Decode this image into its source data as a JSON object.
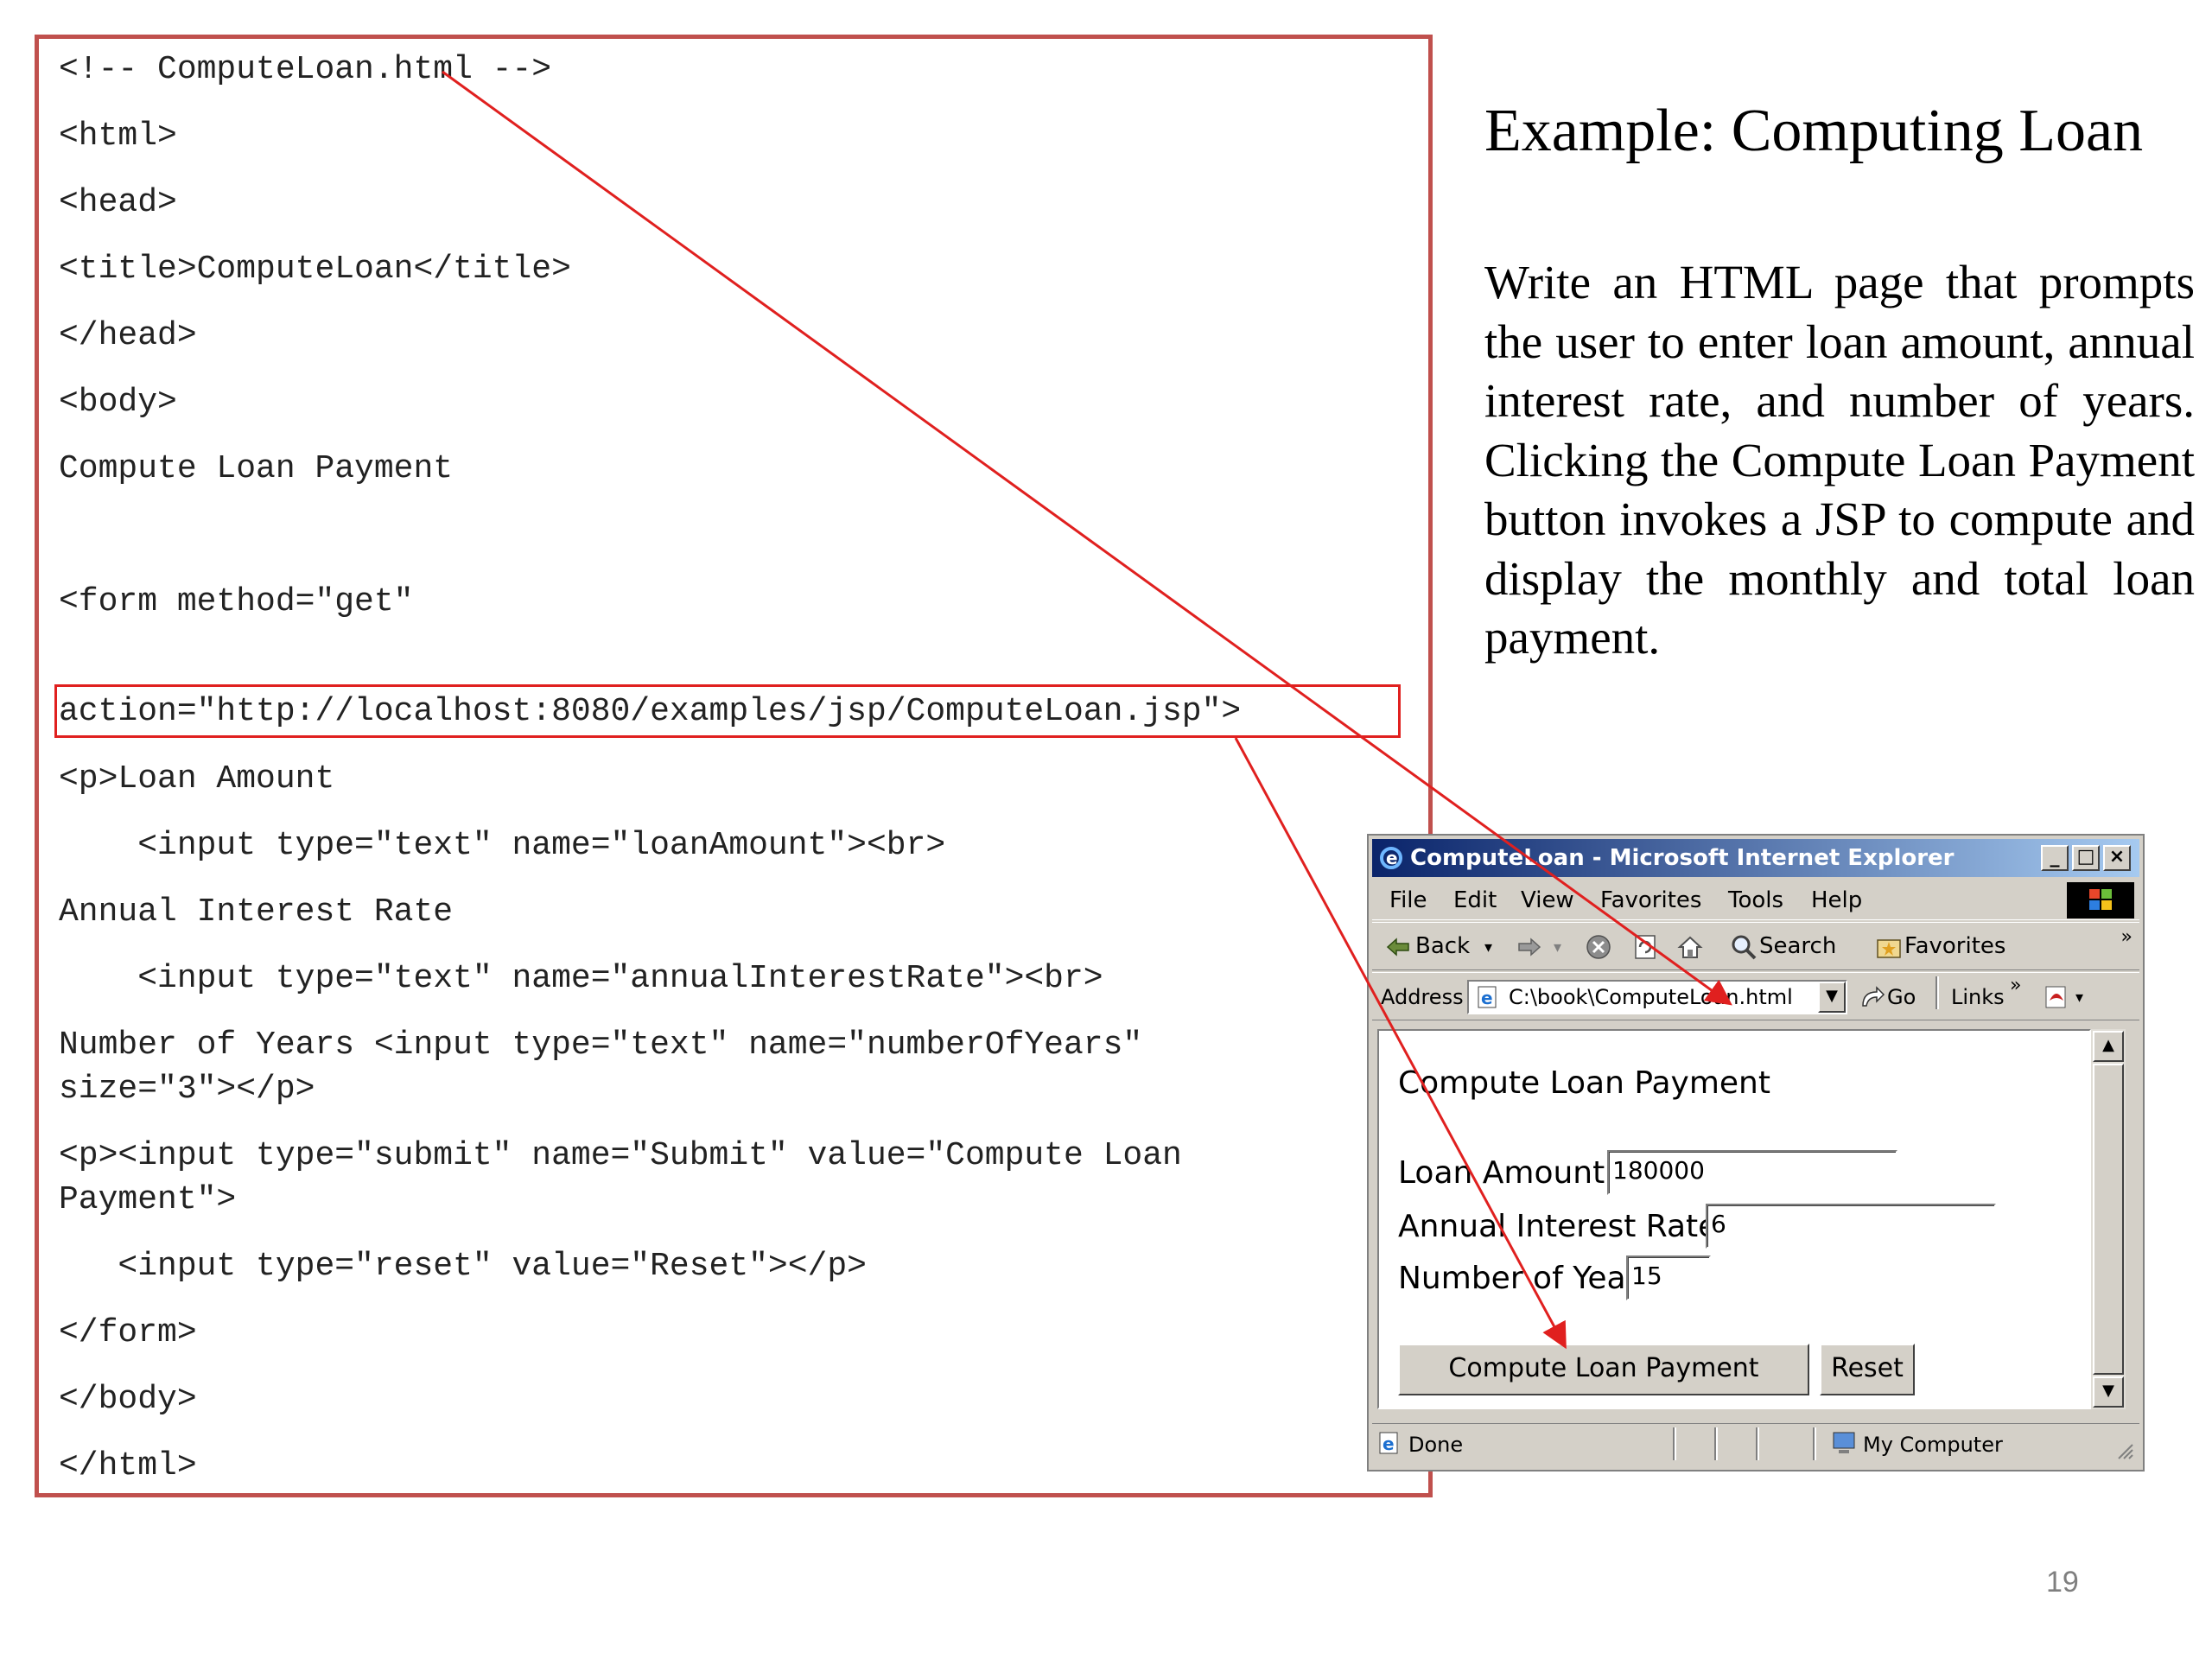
{
  "code": {
    "lines": [
      "<!-- ComputeLoan.html -->",
      "<html>",
      "<head>",
      "<title>ComputeLoan</title>",
      "</head>",
      "<body>",
      "Compute Loan Payment",
      "<form method=\"get\"",
      "action=\"http://localhost:8080/examples/jsp/ComputeLoan.jsp\">",
      "<p>Loan Amount",
      "    <input type=\"text\" name=\"loanAmount\"><br>",
      "Annual Interest Rate",
      "    <input type=\"text\" name=\"annualInterestRate\"><br>",
      "Number of Years <input type=\"text\" name=\"numberOfYears\"",
      "size=\"3\"></p>",
      "<p><input type=\"submit\" name=\"Submit\" value=\"Compute Loan",
      "Payment\">",
      "   <input type=\"reset\" value=\"Reset\"></p>",
      "</form>",
      "</body>",
      "</html>"
    ]
  },
  "slide": {
    "title": "Example: Computing Loan",
    "description": "Write an HTML page that prompts the user to enter loan amount, annual interest rate, and number of years. Clicking the Compute Loan Payment button invokes a JSP to compute and display the monthly and total loan payment.",
    "page_number": "19"
  },
  "browser": {
    "window_title": "ComputeLoan - Microsoft Internet Explorer",
    "menu": [
      "File",
      "Edit",
      "View",
      "Favorites",
      "Tools",
      "Help"
    ],
    "toolbar": {
      "back": "Back",
      "search": "Search",
      "favorites": "Favorites"
    },
    "address_label": "Address",
    "address_value": "C:\\book\\ComputeLoan.html",
    "go_label": "Go",
    "links_label": "Links",
    "status_text": "Done",
    "zone_text": "My Computer",
    "colors": {
      "titlebar_start": "#0a246a",
      "titlebar_end": "#a6caf0",
      "chrome": "#d4d0c8",
      "arrow": "#e0201f",
      "frame": "#c0504d"
    }
  },
  "page": {
    "heading": "Compute Loan Payment",
    "loan_amount_label": "Loan Amount",
    "loan_amount_value": "180000",
    "interest_label": "Annual Interest Rate",
    "interest_value": "6",
    "years_label": "Number of Years",
    "years_value": "15",
    "submit_label": "Compute Loan Payment",
    "reset_label": "Reset"
  }
}
